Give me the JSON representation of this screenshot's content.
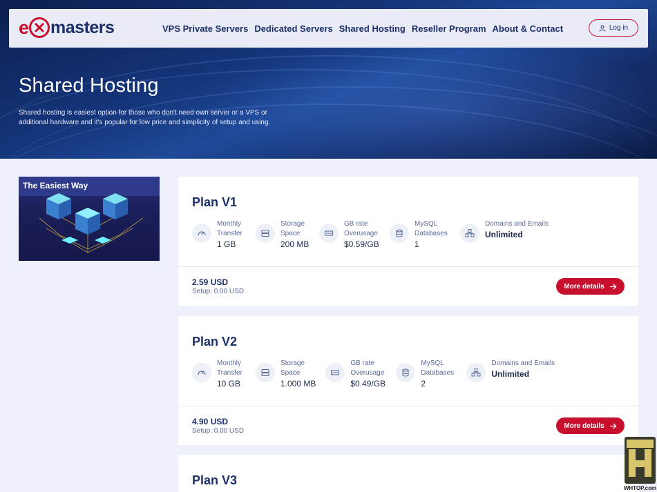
{
  "header": {
    "logo": {
      "e": "e",
      "x": "x",
      "text": "masters"
    },
    "nav": [
      "VPS Private Servers",
      "Dedicated Servers",
      "Shared Hosting",
      "Reseller Program",
      "About & Contact"
    ],
    "login": "Log in"
  },
  "hero": {
    "title": "Shared Hosting",
    "description": "Shared hosting is easiest option for those who don't need own server or a VPS or additional hardware and it's popular for low price and simplicity of setup and using."
  },
  "promo": {
    "title": "The Easiest Way"
  },
  "plans": [
    {
      "name": "Plan V1",
      "specs": [
        {
          "label": "Monthly Transfer",
          "value": "1 GB",
          "icon": "gauge-icon"
        },
        {
          "label": "Storage Space",
          "value": "200 MB",
          "icon": "storage-icon"
        },
        {
          "label": "GB rate Overusage",
          "value": "$0.59/GB",
          "icon": "memory-icon"
        },
        {
          "label": "MySQL Databases",
          "value": "1",
          "icon": "database-icon"
        },
        {
          "label": "Domains and Emails",
          "value": "Unlimited",
          "icon": "network-icon"
        }
      ],
      "price": "2.59 USD",
      "setup": "Setup: 0.00 USD",
      "button": "More details"
    },
    {
      "name": "Plan V2",
      "specs": [
        {
          "label": "Monthly Transfer",
          "value": "10 GB",
          "icon": "gauge-icon"
        },
        {
          "label": "Storage Space",
          "value": "1.000 MB",
          "icon": "storage-icon"
        },
        {
          "label": "GB rate Overusage",
          "value": "$0.49/GB",
          "icon": "memory-icon"
        },
        {
          "label": "MySQL Databases",
          "value": "2",
          "icon": "database-icon"
        },
        {
          "label": "Domains and Emails",
          "value": "Unlimited",
          "icon": "network-icon"
        }
      ],
      "price": "4.90 USD",
      "setup": "Setup: 0.00 USD",
      "button": "More details"
    },
    {
      "name": "Plan V3"
    }
  ],
  "watermark": {
    "text": "WHTOP.com"
  },
  "colors": {
    "brand_red": "#c8102e",
    "brand_navy": "#1c2f6b",
    "page_bg": "#eef0fb"
  }
}
